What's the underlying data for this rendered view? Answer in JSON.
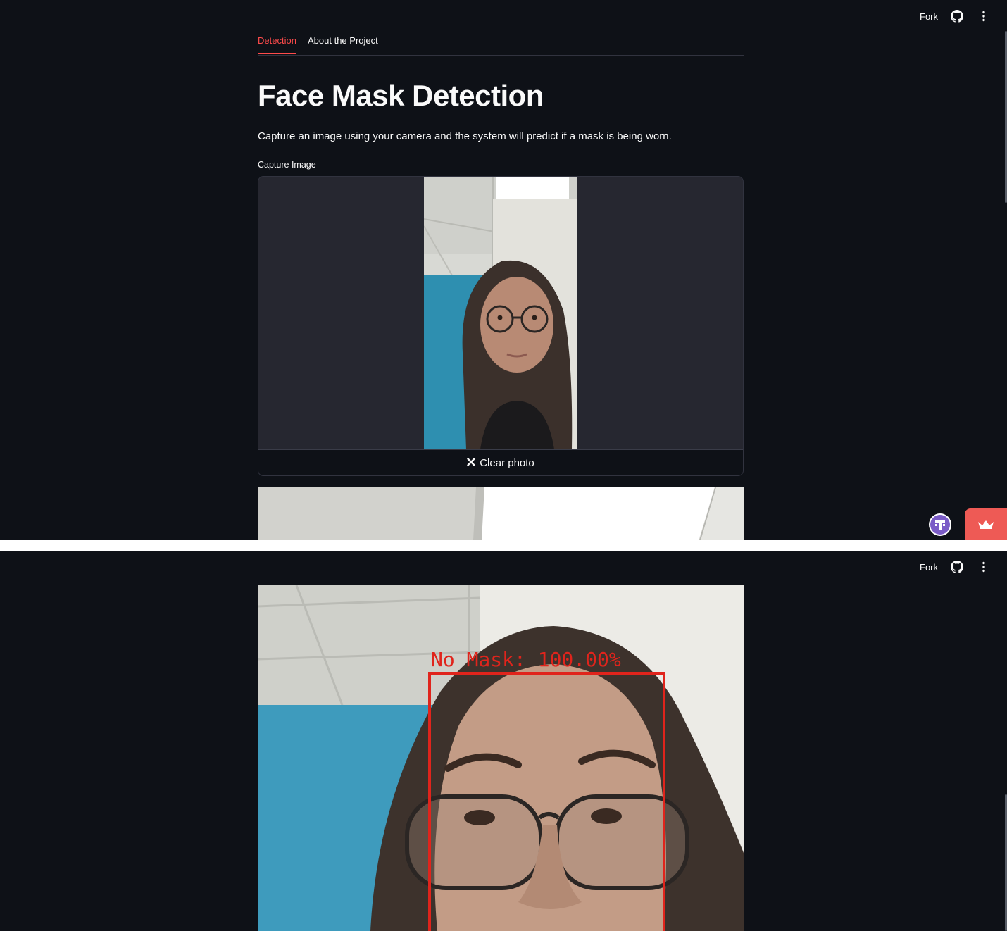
{
  "header": {
    "fork_label": "Fork",
    "github_icon": "github-icon",
    "menu_icon": "more-vertical-icon"
  },
  "tabs": [
    {
      "label": "Detection",
      "active": true
    },
    {
      "label": "About the Project",
      "active": false
    }
  ],
  "main": {
    "title": "Face Mask Detection",
    "intro": "Capture an image using your camera and the system will predict if a mask is being worn.",
    "camera_label": "Capture Image",
    "clear_button": "Clear photo",
    "clear_icon": "close-icon"
  },
  "result": {
    "prediction_label": "No Mask: 100.00%"
  },
  "colors": {
    "background": "#0e1117",
    "accent": "#ff4b4b",
    "box_color": "#e0241c",
    "crown_button": "#ee5a55"
  }
}
